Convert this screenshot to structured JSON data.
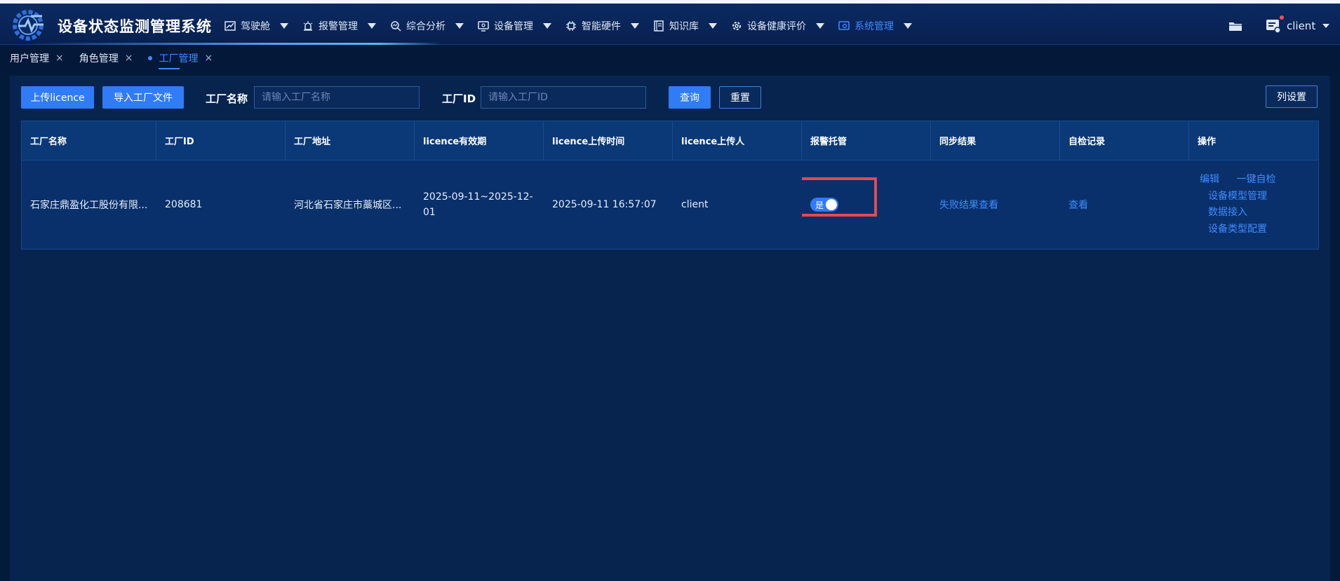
{
  "app": {
    "title": "设备状态监测管理系统"
  },
  "nav": [
    {
      "label": "驾驶舱",
      "icon": "chart-line-icon"
    },
    {
      "label": "报警管理",
      "icon": "alarm-icon"
    },
    {
      "label": "综合分析",
      "icon": "analysis-icon"
    },
    {
      "label": "设备管理",
      "icon": "device-icon"
    },
    {
      "label": "智能硬件",
      "icon": "chip-icon"
    },
    {
      "label": "知识库",
      "icon": "book-icon"
    },
    {
      "label": "设备健康评价",
      "icon": "gear-icon"
    },
    {
      "label": "系统管理",
      "icon": "system-icon",
      "active": true
    }
  ],
  "user": {
    "name": "client"
  },
  "tabs": [
    {
      "label": "用户管理"
    },
    {
      "label": "角色管理"
    },
    {
      "label": "工厂管理",
      "active": true
    }
  ],
  "toolbar": {
    "upload_licence": "上传licence",
    "import_factory": "导入工厂文件",
    "factory_name_label": "工厂名称",
    "factory_name_placeholder": "请输入工厂名称",
    "factory_id_label": "工厂ID",
    "factory_id_placeholder": "请输入工厂ID",
    "query": "查询",
    "reset": "重置",
    "column_settings": "列设置"
  },
  "table": {
    "headers": [
      "工厂名称",
      "工厂ID",
      "工厂地址",
      "licence有效期",
      "licence上传时间",
      "licence上传人",
      "报警托管",
      "同步结果",
      "自检记录",
      "操作"
    ],
    "rows": [
      {
        "name": "石家庄鼎盈化工股份有限...",
        "id": "208681",
        "address": "河北省石家庄市藁城区...",
        "validity": "2025-09-11~2025-12-01",
        "upload_time": "2025-09-11 16:57:07",
        "uploader": "client",
        "alarm_hosting": "是",
        "sync_result": "失败结果查看",
        "self_check": "查看",
        "ops": [
          "编辑",
          "一键自检",
          "设备模型管理",
          "数据接入",
          "设备类型配置"
        ]
      }
    ]
  },
  "colors": {
    "accent": "#2f7cf6",
    "link": "#3f8bff",
    "highlight": "#e5494f"
  }
}
